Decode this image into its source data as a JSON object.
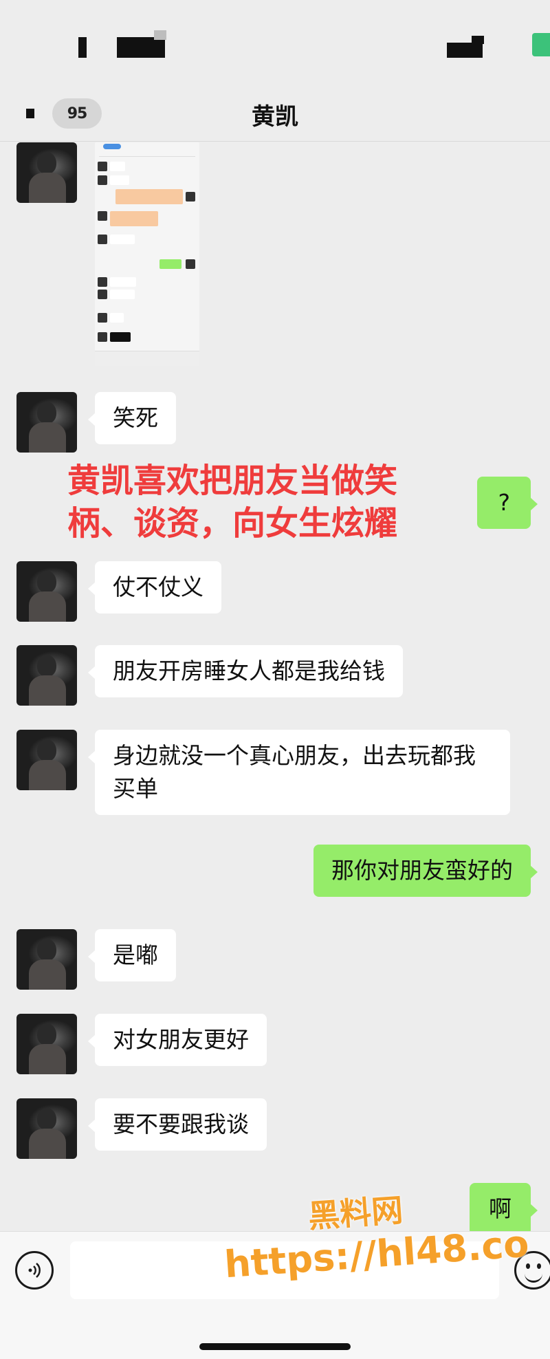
{
  "header": {
    "back_badge": "95",
    "title": "黄凯"
  },
  "caption": {
    "line1": "黄凯喜欢把朋友当做笑",
    "line2": "柄、谈资，向女生炫耀"
  },
  "messages": [
    {
      "side": "in",
      "type": "image"
    },
    {
      "side": "in",
      "text": "笑死"
    },
    {
      "side": "out",
      "text": "?"
    },
    {
      "side": "in",
      "text": "仗不仗义"
    },
    {
      "side": "in",
      "text": "朋友开房睡女人都是我给钱"
    },
    {
      "side": "in",
      "text": "身边就没一个真心朋友，出去玩都我买单"
    },
    {
      "side": "out",
      "text": "那你对朋友蛮好的"
    },
    {
      "side": "in",
      "text": "是嘟"
    },
    {
      "side": "in",
      "text": "对女朋友更好"
    },
    {
      "side": "in",
      "text": "要不要跟我谈"
    },
    {
      "side": "out",
      "text": "啊"
    }
  ],
  "input": {
    "voice_icon": "voice-icon",
    "emoji_icon": "emoji-icon"
  },
  "watermark": {
    "line1": "黑料网",
    "line2": "https://hl48.co"
  },
  "colors": {
    "background": "#ededed",
    "incoming_bubble": "#ffffff",
    "outgoing_bubble": "#95ec69",
    "caption": "#ef3c3c",
    "watermark": "#f5a02a"
  }
}
